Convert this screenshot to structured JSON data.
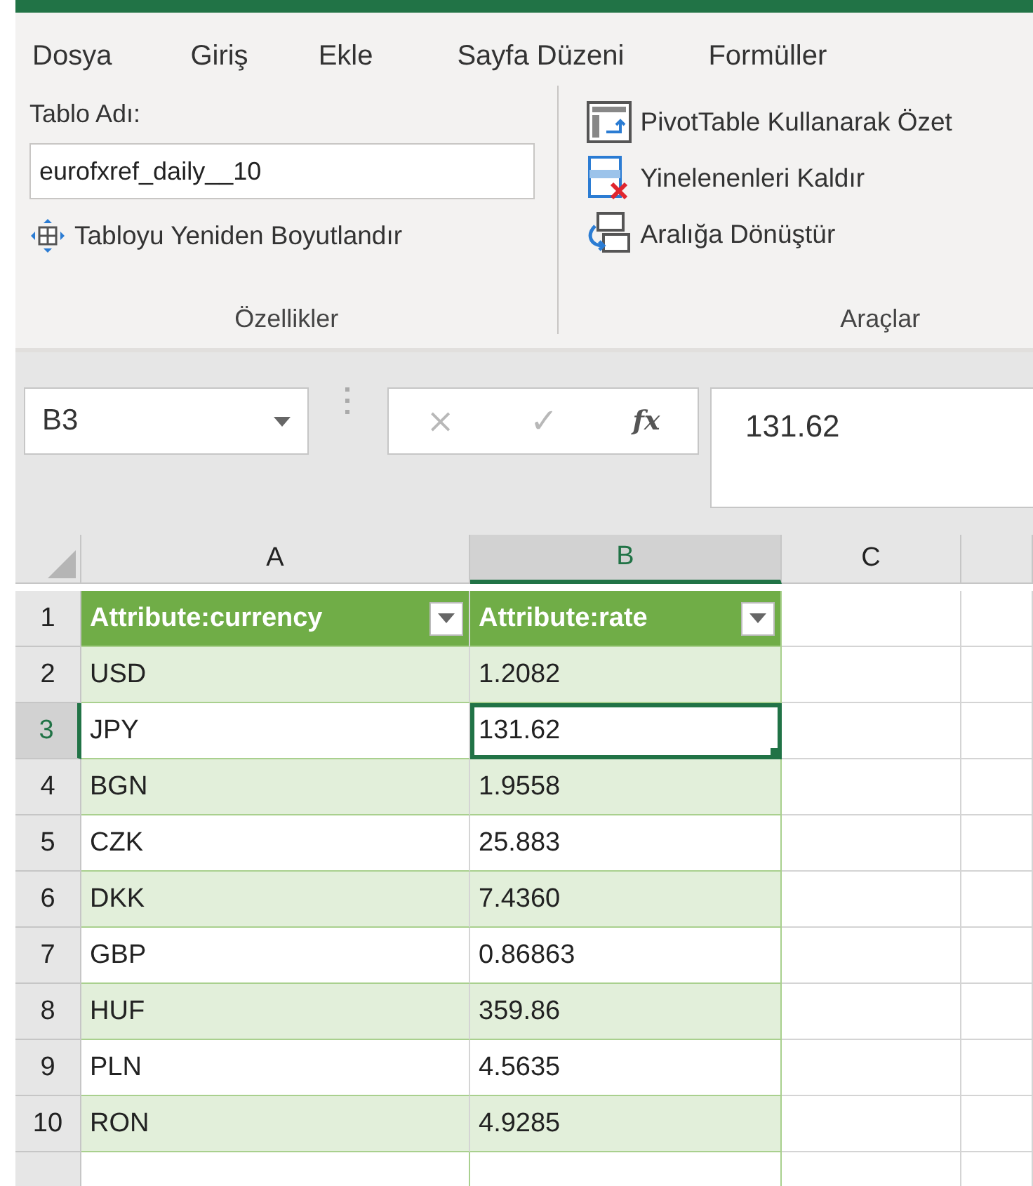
{
  "ribbon_tabs": [
    {
      "label": "Dosya"
    },
    {
      "label": "Giriş"
    },
    {
      "label": "Ekle"
    },
    {
      "label": "Sayfa Düzeni"
    },
    {
      "label": "Formüller"
    }
  ],
  "groups": [
    {
      "kind": "properties",
      "title": "Özellikler",
      "field_label": "Tablo Adı:",
      "field_value": "eurofxref_daily__10",
      "button": "Tabloyu Yeniden Boyutlandır"
    },
    {
      "kind": "tools",
      "title": "Araçlar",
      "buttons": [
        {
          "label": "PivotTable Kullanarak Özet"
        },
        {
          "label": "Yinelenenleri Kaldır"
        },
        {
          "label": "Aralığa Dönüştür"
        }
      ]
    }
  ],
  "formula_bar": {
    "name_box": "B3",
    "cancel": "×",
    "enter": "✓",
    "function": "fx",
    "formula": "131.62"
  },
  "columns": [
    {
      "label": "A",
      "selected": false
    },
    {
      "label": "B",
      "selected": true
    },
    {
      "label": "C",
      "selected": false
    }
  ],
  "rows": [
    {
      "number": "1",
      "selected": false,
      "kind": "header",
      "cells": [
        "Attribute:currency",
        "Attribute:rate"
      ]
    },
    {
      "number": "2",
      "selected": false,
      "kind": "data",
      "cells": [
        "USD",
        "1.2082"
      ]
    },
    {
      "number": "3",
      "selected": true,
      "kind": "data",
      "cells": [
        "JPY",
        "131.62"
      ],
      "active_cells": [
        false,
        true
      ]
    },
    {
      "number": "4",
      "selected": false,
      "kind": "data",
      "cells": [
        "BGN",
        "1.9558"
      ]
    },
    {
      "number": "5",
      "selected": false,
      "kind": "data",
      "cells": [
        "CZK",
        "25.883"
      ]
    },
    {
      "number": "6",
      "selected": false,
      "kind": "data",
      "cells": [
        "DKK",
        "7.4360"
      ]
    },
    {
      "number": "7",
      "selected": false,
      "kind": "data",
      "cells": [
        "GBP",
        "0.86863"
      ]
    },
    {
      "number": "8",
      "selected": false,
      "kind": "data",
      "cells": [
        "HUF",
        "359.86"
      ]
    },
    {
      "number": "9",
      "selected": false,
      "kind": "data",
      "cells": [
        "PLN",
        "4.5635"
      ]
    },
    {
      "number": "10",
      "selected": false,
      "kind": "data",
      "cells": [
        "RON",
        "4.9285"
      ]
    }
  ]
}
